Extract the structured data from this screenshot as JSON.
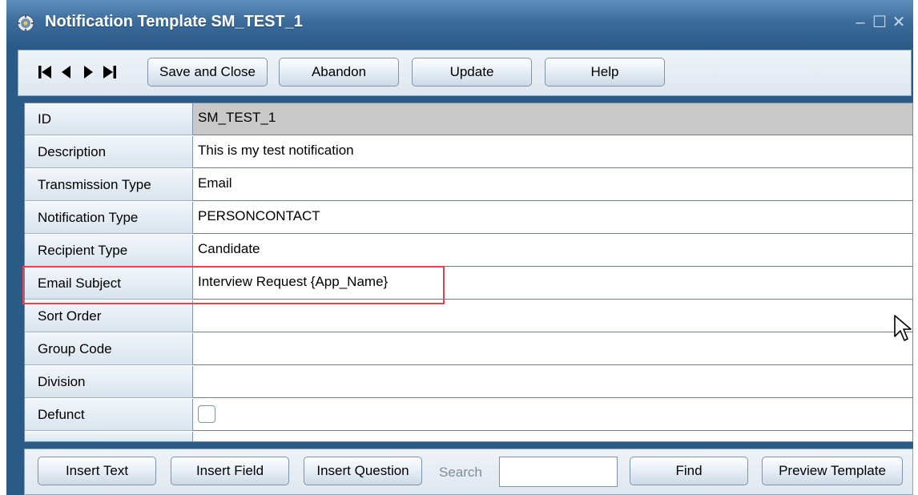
{
  "window": {
    "title": "Notification Template SM_TEST_1",
    "minimize_glyph": "–",
    "maximize_glyph": "☐",
    "close_glyph": "✕"
  },
  "toolbar": {
    "nav_icons": [
      "first-record-icon",
      "previous-record-icon",
      "next-record-icon",
      "last-record-icon"
    ],
    "save_close_label": "Save and Close",
    "abandon_label": "Abandon",
    "update_label": "Update",
    "help_label": "Help"
  },
  "form": {
    "fields": [
      {
        "label": "ID",
        "value": "SM_TEST_1"
      },
      {
        "label": "Description",
        "value": "This is my test notification"
      },
      {
        "label": "Transmission Type",
        "value": "Email"
      },
      {
        "label": "Notification Type",
        "value": "PERSONCONTACT"
      },
      {
        "label": "Recipient Type",
        "value": "Candidate"
      },
      {
        "label": "Email Subject",
        "value": "Interview Request {App_Name}"
      },
      {
        "label": "Sort Order",
        "value": ""
      },
      {
        "label": "Group Code",
        "value": ""
      },
      {
        "label": "Division",
        "value": ""
      },
      {
        "label": "Defunct",
        "checked": false
      }
    ]
  },
  "bottom": {
    "insert_text_label": "Insert Text",
    "insert_field_label": "Insert Field",
    "insert_question_label": "Insert Question",
    "search_label": "Search",
    "search_value": "",
    "find_label": "Find",
    "preview_label": "Preview Template"
  },
  "colors": {
    "title_bar": "#3c6c9b",
    "readonly_field": "#c9c9c9",
    "highlight_border": "#e8414b"
  }
}
